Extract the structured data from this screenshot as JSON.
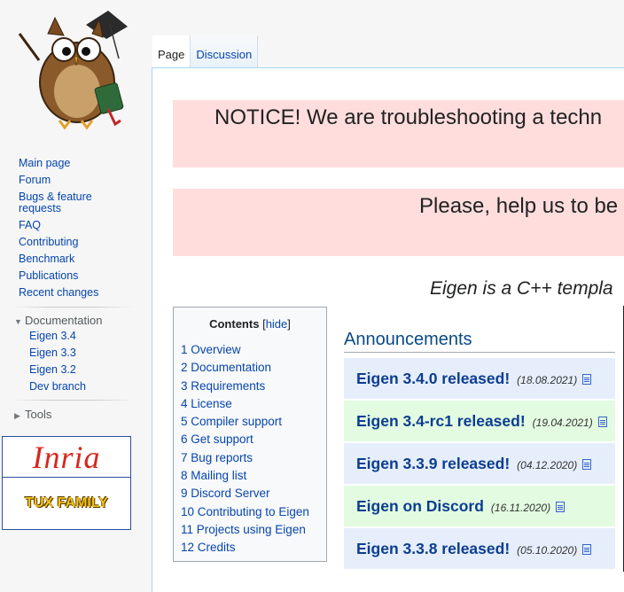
{
  "sidebar": {
    "links": [
      "Main page",
      "Forum",
      "Bugs & feature requests",
      "FAQ",
      "Contributing",
      "Benchmark",
      "Publications",
      "Recent changes"
    ],
    "documentation_label": "Documentation",
    "documentation_links": [
      "Eigen 3.4",
      "Eigen 3.3",
      "Eigen 3.2",
      "Dev branch"
    ],
    "tools_label": "Tools",
    "sponsors": [
      "Inria",
      "TUX FAMILY"
    ]
  },
  "tabs": {
    "page": "Page",
    "discussion": "Discussion"
  },
  "notices": [
    "NOTICE! We are troubleshooting a techn",
    "Please, help us to be"
  ],
  "intro": "Eigen is a C++ templa",
  "toc": {
    "title": "Contents",
    "hide": "hide",
    "items": [
      "1 Overview",
      "2 Documentation",
      "3 Requirements",
      "4 License",
      "5 Compiler support",
      "6 Get support",
      "7 Bug reports",
      "8 Mailing list",
      "9 Discord Server",
      "10 Contributing to Eigen",
      "11 Projects using Eigen",
      "12 Credits"
    ]
  },
  "announcements": {
    "heading": "Announcements",
    "items": [
      {
        "title": "Eigen 3.4.0 released!",
        "date": "(18.08.2021)",
        "color": "#e6eefb"
      },
      {
        "title": "Eigen 3.4-rc1 released!",
        "date": "(19.04.2021)",
        "color": "#e3fbe0"
      },
      {
        "title": "Eigen 3.3.9 released!",
        "date": "(04.12.2020)",
        "color": "#e6eefb"
      },
      {
        "title": "Eigen on Discord",
        "date": "(16.11.2020)",
        "color": "#e3fbe0"
      },
      {
        "title": "Eigen 3.3.8 released!",
        "date": "(05.10.2020)",
        "color": "#e6eefb"
      }
    ]
  }
}
